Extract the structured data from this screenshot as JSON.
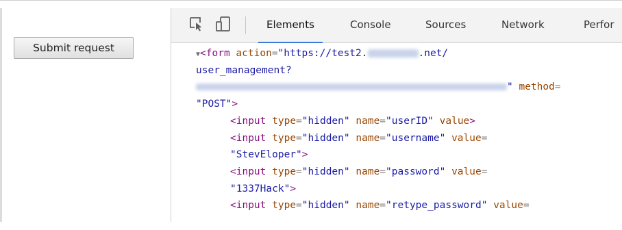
{
  "left_pane": {
    "submit_label": "Submit request"
  },
  "toolbar": {
    "icons": [
      "select-element-icon",
      "device-toggle-icon"
    ],
    "tabs": [
      {
        "label": "Elements",
        "active": true
      },
      {
        "label": "Console",
        "active": false
      },
      {
        "label": "Sources",
        "active": false
      },
      {
        "label": "Network",
        "active": false
      },
      {
        "label": "Perfor",
        "active": false
      }
    ]
  },
  "code": {
    "form_tag": "form",
    "action_attr": "action",
    "action_prefix": "https://test2.",
    "action_suffix": ".net/",
    "action_path": "user_management?",
    "method_attr": "method",
    "method_value": "POST",
    "inputs": [
      {
        "tag": "input",
        "type": "hidden",
        "name": "userID",
        "value": ""
      },
      {
        "tag": "input",
        "type": "hidden",
        "name": "username",
        "value": "StevEloper"
      },
      {
        "tag": "input",
        "type": "hidden",
        "name": "password",
        "value": "1337Hack"
      },
      {
        "tag": "input",
        "type": "hidden",
        "name": "retype_password",
        "value": ""
      }
    ]
  },
  "colors": {
    "tag": "#881280",
    "attr_name": "#994500",
    "attr_value": "#1a1aa6",
    "active_tab_underline": "#3879d9"
  }
}
